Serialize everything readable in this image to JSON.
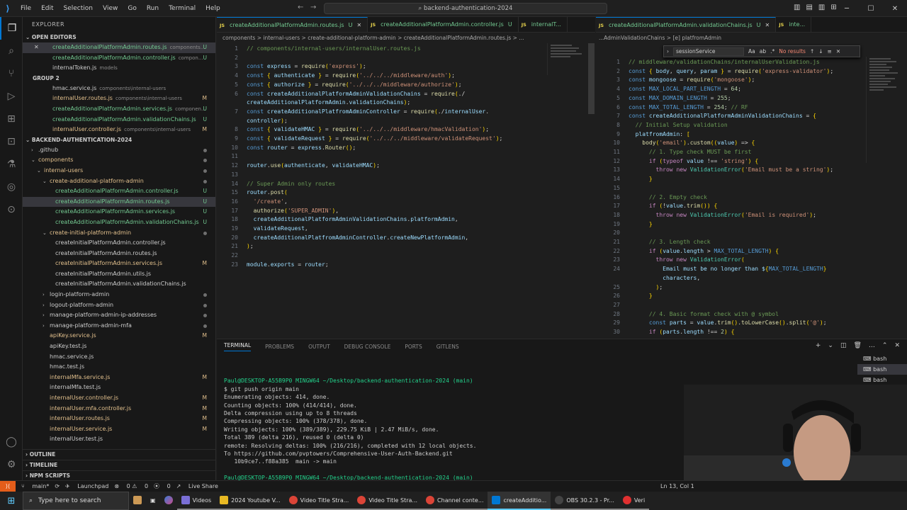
{
  "titlebar": {
    "menus": [
      "File",
      "Edit",
      "Selection",
      "View",
      "Go",
      "Run",
      "Terminal",
      "Help"
    ],
    "search": "backend-authentication-2024"
  },
  "explorer": {
    "title": "EXPLORER",
    "open_editors": "OPEN EDITORS",
    "group2": "GROUP 2",
    "root": "BACKEND-AUTHENTICATION-2024",
    "outline": "OUTLINE",
    "timeline": "TIMELINE",
    "npm": "NPM SCRIPTS",
    "open_items": [
      {
        "name": "createAdditionalPlatformAdmin.routes.js",
        "desc": "components...",
        "status": "U"
      },
      {
        "name": "createAdditionalPlatformAdmin.controller.js",
        "desc": "compon...",
        "status": "U"
      },
      {
        "name": "internalToken.js",
        "desc": "models",
        "status": ""
      }
    ],
    "group2_items": [
      {
        "name": "hmac.service.js",
        "desc": "components\\internal-users",
        "status": ""
      },
      {
        "name": "internalUser.routes.js",
        "desc": "components\\internal-users",
        "status": "M"
      },
      {
        "name": "createAdditionalPlatformAdmin.services.js",
        "desc": "componen...",
        "status": "U"
      },
      {
        "name": "createAdditionalPlatformAdmin.validationChains.js",
        "desc": "",
        "status": "U"
      },
      {
        "name": "internalUser.controller.js",
        "desc": "components\\internal-users",
        "status": "M"
      }
    ],
    "tree": [
      {
        "name": ".github",
        "ind": 1,
        "type": "folder"
      },
      {
        "name": "components",
        "ind": 1,
        "type": "folder-open"
      },
      {
        "name": "internal-users",
        "ind": 2,
        "type": "folder-open"
      },
      {
        "name": "create-additional-platform-admin",
        "ind": 3,
        "type": "folder-open"
      },
      {
        "name": "createAdditionalPlatformAdmin.controller.js",
        "ind": 4,
        "type": "file",
        "status": "U"
      },
      {
        "name": "createAdditionalPlatformAdmin.routes.js",
        "ind": 4,
        "type": "file",
        "status": "U"
      },
      {
        "name": "createAdditionalPlatformAdmin.services.js",
        "ind": 4,
        "type": "file",
        "status": "U"
      },
      {
        "name": "createAdditionalPlatformAdmin.validationChains.js",
        "ind": 4,
        "type": "file",
        "status": "U"
      },
      {
        "name": "create-initial-platform-admin",
        "ind": 3,
        "type": "folder-open"
      },
      {
        "name": "createInitialPlatformAdmin.controller.js",
        "ind": 4,
        "type": "file",
        "status": ""
      },
      {
        "name": "createInitialPlatformAdmin.routes.js",
        "ind": 4,
        "type": "file",
        "status": ""
      },
      {
        "name": "createInitialPlatformAdmin.services.js",
        "ind": 4,
        "type": "file",
        "status": "M"
      },
      {
        "name": "createInitialPlatformAdmin.utils.js",
        "ind": 4,
        "type": "file",
        "status": ""
      },
      {
        "name": "createInitialPlatformAdmin.validationChains.js",
        "ind": 4,
        "type": "file",
        "status": ""
      },
      {
        "name": "login-platform-admin",
        "ind": 3,
        "type": "folder"
      },
      {
        "name": "logout-platform-admin",
        "ind": 3,
        "type": "folder"
      },
      {
        "name": "manage-platform-admin-ip-addresses",
        "ind": 3,
        "type": "folder"
      },
      {
        "name": "manage-platform-admin-mfa",
        "ind": 3,
        "type": "folder"
      },
      {
        "name": "apiKey.service.js",
        "ind": 3,
        "type": "file",
        "status": "M"
      },
      {
        "name": "apiKey.test.js",
        "ind": 3,
        "type": "file",
        "status": ""
      },
      {
        "name": "hmac.service.js",
        "ind": 3,
        "type": "file",
        "status": ""
      },
      {
        "name": "hmac.test.js",
        "ind": 3,
        "type": "file",
        "status": ""
      },
      {
        "name": "internalMfa.service.js",
        "ind": 3,
        "type": "file",
        "status": "M"
      },
      {
        "name": "internalMfa.test.js",
        "ind": 3,
        "type": "file",
        "status": ""
      },
      {
        "name": "internalUser.controller.js",
        "ind": 3,
        "type": "file",
        "status": "M"
      },
      {
        "name": "internalUser.mfa.controller.js",
        "ind": 3,
        "type": "file",
        "status": "M"
      },
      {
        "name": "internalUser.routes.js",
        "ind": 3,
        "type": "file",
        "status": "M"
      },
      {
        "name": "internalUser.service.js",
        "ind": 3,
        "type": "file",
        "status": "M"
      },
      {
        "name": "internalUser.test.js",
        "ind": 3,
        "type": "file",
        "status": ""
      }
    ]
  },
  "tabs_left": [
    {
      "name": "createAdditionalPlatformAdmin.routes.js",
      "status": "U",
      "active": true
    },
    {
      "name": "createAdditionalPlatformAdmin.controller.js",
      "status": "U",
      "active": false
    },
    {
      "name": "internalT...",
      "status": "",
      "active": false
    }
  ],
  "tabs_right": [
    {
      "name": "createAdditionalPlatformAdmin.validationChains.js",
      "status": "U",
      "active": true
    },
    {
      "name": "inte...",
      "status": "",
      "active": false
    }
  ],
  "breadcrumbs_left": "components > internal-users > create-additional-platform-admin > createAdditionalPlatformAdmin.routes.js > ...",
  "breadcrumbs_right": "...AdminValidationChains > [e] platfromAdmin",
  "find_widget": {
    "value": "sessionService",
    "result": "No results"
  },
  "panel": {
    "tabs": [
      "TERMINAL",
      "PROBLEMS",
      "OUTPUT",
      "DEBUG CONSOLE",
      "PORTS",
      "GITLENS"
    ],
    "terminal_list": [
      "bash",
      "bash",
      "bash"
    ]
  },
  "terminal_lines": [
    "",
    "Paul@DESKTOP-A55B9P0 MINGW64 ~/Desktop/backend-authentication-2024 (main)",
    "$ git push origin main",
    "Enumerating objects: 414, done.",
    "Counting objects: 100% (414/414), done.",
    "Delta compression using up to 8 threads",
    "Compressing objects: 100% (378/378), done.",
    "Writing objects: 100% (389/389), 229.75 KiB | 2.47 MiB/s, done.",
    "Total 389 (delta 216), reused 0 (delta 0)",
    "remote: Resolving deltas: 100% (216/216), completed with 12 local objects.",
    "To https://github.com/pvptowers/Comprehensive-User-Auth-Backend.git",
    "   10b9ce7..f88a385  main -> main",
    "",
    "Paul@DESKTOP-A55B9P0 MINGW64 ~/Desktop/backend-authentication-2024 (main)",
    "$ "
  ],
  "statusbar": {
    "branch": "main*",
    "launchpad": "Launchpad",
    "errors": "0",
    "warnings": "0",
    "ports": "0",
    "live_share": "Live Share",
    "position": "Ln 13, Col 1"
  },
  "taskbar": {
    "search_placeholder": "Type here to search",
    "items": [
      "Videos",
      "2024 Youtube V...",
      "Video Title Stra...",
      "Video Title Stra...",
      "Channel conte...",
      "createAdditio...",
      "OBS 30.2.3 - Pr...",
      "Veri"
    ]
  },
  "code_left": [
    "// components/internal-users/internalUser.routes.js",
    "",
    "const express = require('express');",
    "const { authenticate } = require('../../../middleware/auth');",
    "const { authorize } = require('../../../middleware/authorize');",
    "const createAdditionalPlatformAdminValidationChains = require('./",
    "createAdditionalPlatformAdmin.validationChains');",
    "const createAdditionalPlatfromAdminController = require('./internalUser.",
    "controller');",
    "const { validateHMAC } = require('../../../middleware/hmacValidation');",
    "const { validateRequest } = require('../../../middleware/validateRequest');",
    "const router = express.Router();",
    "",
    "router.use(authenticate, validateHMAC);",
    "",
    "// Super Admin only routes",
    "router.post(",
    "  '/create',",
    "  authorize('SUPER_ADMIN'),",
    "  createAdditionalPlatformAdminValidationChains.platformAdmin,",
    "  validateRequest,",
    "  createAdditionalPlatfromAdminController.createNewPlatformAdmin,",
    ");",
    "",
    "module.exports = router;"
  ],
  "code_left_numbers": [
    "1",
    "2",
    "3",
    "4",
    "5",
    "6",
    "",
    "7",
    "",
    "8",
    "9",
    "10",
    "11",
    "12",
    "13",
    "14",
    "15",
    "16",
    "17",
    "18",
    "19",
    "20",
    "21",
    "22",
    "23"
  ],
  "code_right": [
    "// middleware/validationChains/internalUserValidation.js",
    "const { body, query, param } = require('express-validator');",
    "const mongoose = require('mongoose');",
    "const MAX_LOCAL_PART_LENGTH = 64;",
    "const MAX_DOMAIN_LENGTH = 255;",
    "const MAX_TOTAL_LENGTH = 254; // RF",
    "const createAdditionalPlatformAdminValidationChains = {",
    "  // Initial Setup validation",
    "  platfromAdmin: [",
    "    body('email').custom((value) => {",
    "      // 1. Type check MUST be first",
    "      if (typeof value !== 'string') {",
    "        throw new ValidationError('Email must be a string');",
    "      }",
    "",
    "      // 2. Empty check",
    "      if (!value.trim()) {",
    "        throw new ValidationError('Email is required');",
    "      }",
    "",
    "      // 3. Length check",
    "      if (value.length > MAX_TOTAL_LENGTH) {",
    "        throw new ValidationError(",
    "          `Email must be no longer than ${MAX_TOTAL_LENGTH}",
    "          characters`,",
    "        );",
    "      }",
    "",
    "      // 4. Basic format check with @ symbol",
    "      const parts = value.trim().toLowerCase().split('@');",
    "      if (parts.length !== 2) {"
  ],
  "code_right_numbers": [
    "1",
    "2",
    "3",
    "4",
    "5",
    "6",
    "7",
    "8",
    "9",
    "10",
    "11",
    "12",
    "13",
    "14",
    "15",
    "16",
    "17",
    "18",
    "19",
    "20",
    "21",
    "22",
    "23",
    "24",
    "",
    "25",
    "26",
    "27",
    "28",
    "29",
    "30"
  ]
}
